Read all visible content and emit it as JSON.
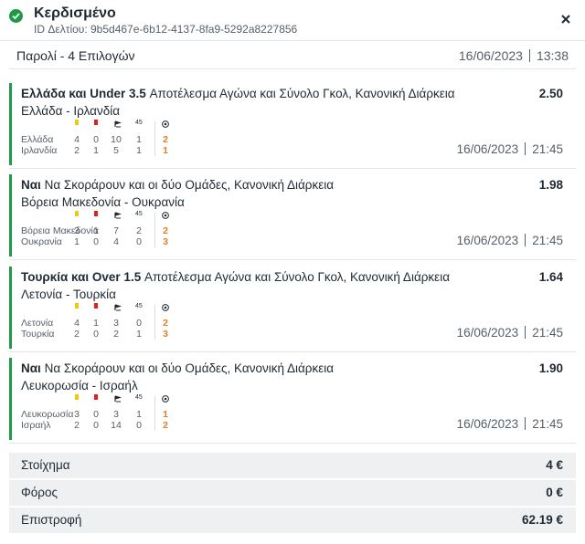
{
  "header": {
    "status": "Κερδισμένο",
    "slip_id": "ID Δελτίου: 9b5d467e-6b12-4137-8fa9-5292a8227856",
    "status_color": "#1f9a48"
  },
  "slip": {
    "bet_type": "Παρολί - 4 Επιλογών",
    "date": "16/06/2023",
    "time": "13:38"
  },
  "stat_icons": [
    "yellow-card-icon",
    "red-card-icon",
    "corner-flag-icon",
    "45",
    "ball-icon"
  ],
  "selections": [
    {
      "pick": "Ελλάδα και Under 3.5",
      "market": "Αποτέλεσμα Αγώνα και Σύνολο Γκολ, Κανονική Διάρκεια",
      "odds": "2.50",
      "match": "Ελλάδα - Ιρλανδία",
      "home": {
        "name": "Ελλάδα",
        "yellow": "4",
        "red": "0",
        "corners": "10",
        "ht": "1",
        "goals": "2"
      },
      "away": {
        "name": "Ιρλανδία",
        "yellow": "2",
        "red": "1",
        "corners": "5",
        "ht": "1",
        "goals": "1"
      },
      "date": "16/06/2023",
      "time": "21:45"
    },
    {
      "pick": "Ναι",
      "market": "Να Σκοράρουν και οι δύο Ομάδες, Κανονική Διάρκεια",
      "odds": "1.98",
      "match": "Βόρεια Μακεδονία - Ουκρανία",
      "home": {
        "name": "Βόρεια Μακεδονία",
        "yellow": "3",
        "red": "1",
        "corners": "7",
        "ht": "2",
        "goals": "2"
      },
      "away": {
        "name": "Ουκρανία",
        "yellow": "1",
        "red": "0",
        "corners": "4",
        "ht": "0",
        "goals": "3"
      },
      "date": "16/06/2023",
      "time": "21:45"
    },
    {
      "pick": "Τουρκία και Over 1.5",
      "market": "Αποτέλεσμα Αγώνα και Σύνολο Γκολ, Κανονική Διάρκεια",
      "odds": "1.64",
      "match": "Λετονία - Τουρκία",
      "home": {
        "name": "Λετονία",
        "yellow": "4",
        "red": "1",
        "corners": "3",
        "ht": "0",
        "goals": "2"
      },
      "away": {
        "name": "Τουρκία",
        "yellow": "2",
        "red": "0",
        "corners": "2",
        "ht": "1",
        "goals": "3"
      },
      "date": "16/06/2023",
      "time": "21:45"
    },
    {
      "pick": "Ναι",
      "market": "Να Σκοράρουν και οι δύο Ομάδες, Κανονική Διάρκεια",
      "odds": "1.90",
      "match": "Λευκορωσία - Ισραήλ",
      "home": {
        "name": "Λευκορωσία",
        "yellow": "3",
        "red": "0",
        "corners": "3",
        "ht": "1",
        "goals": "1"
      },
      "away": {
        "name": "Ισραήλ",
        "yellow": "2",
        "red": "0",
        "corners": "14",
        "ht": "0",
        "goals": "2"
      },
      "date": "16/06/2023",
      "time": "21:45"
    }
  ],
  "summary": {
    "stake_label": "Στοίχημα",
    "stake_value": "4 €",
    "tax_label": "Φόρος",
    "tax_value": "0 €",
    "return_label": "Επιστροφή",
    "return_value": "62.19 €"
  }
}
